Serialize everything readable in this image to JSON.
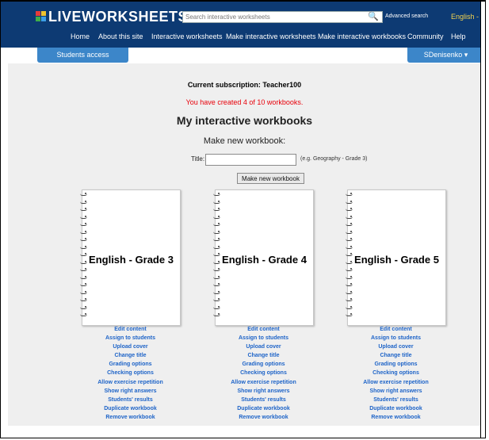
{
  "header": {
    "logo": "LIVEWORKSHEETS",
    "search_placeholder": "Search interactive worksheets",
    "advanced_search": "Advanced search",
    "language": "English - Es",
    "nav": [
      "Home",
      "About this site",
      "Interactive worksheets",
      "Make interactive worksheets",
      "Make interactive workbooks",
      "Community",
      "Help"
    ],
    "students_access": "Students access",
    "user": "SDenisenko ▾"
  },
  "main": {
    "subscription": "Current subscription: Teacher100",
    "created": "You have created 4 of 10 workbooks.",
    "title": "My interactive workbooks",
    "make_new": "Make new workbook:",
    "title_label": "Title:",
    "title_value": "",
    "title_example": "(e.g. Geography - Grade 3)",
    "make_button": "Make new workbook"
  },
  "workbooks": [
    {
      "title": "English - Grade 3"
    },
    {
      "title": "English - Grade 4"
    },
    {
      "title": "English - Grade 5"
    }
  ],
  "workbook_actions": [
    "Edit content",
    "Assign to students",
    "Upload cover",
    "Change title",
    "Grading options",
    "Checking options",
    "Allow exercise repetition",
    "Show right answers",
    "Students' results",
    "Duplicate workbook",
    "Remove workbook"
  ],
  "colors": {
    "header_bg": "#0d3a73",
    "tab_bg": "#3c86c9",
    "link": "#1e64c8",
    "alert": "#e8000a",
    "language": "#f2d24e"
  }
}
